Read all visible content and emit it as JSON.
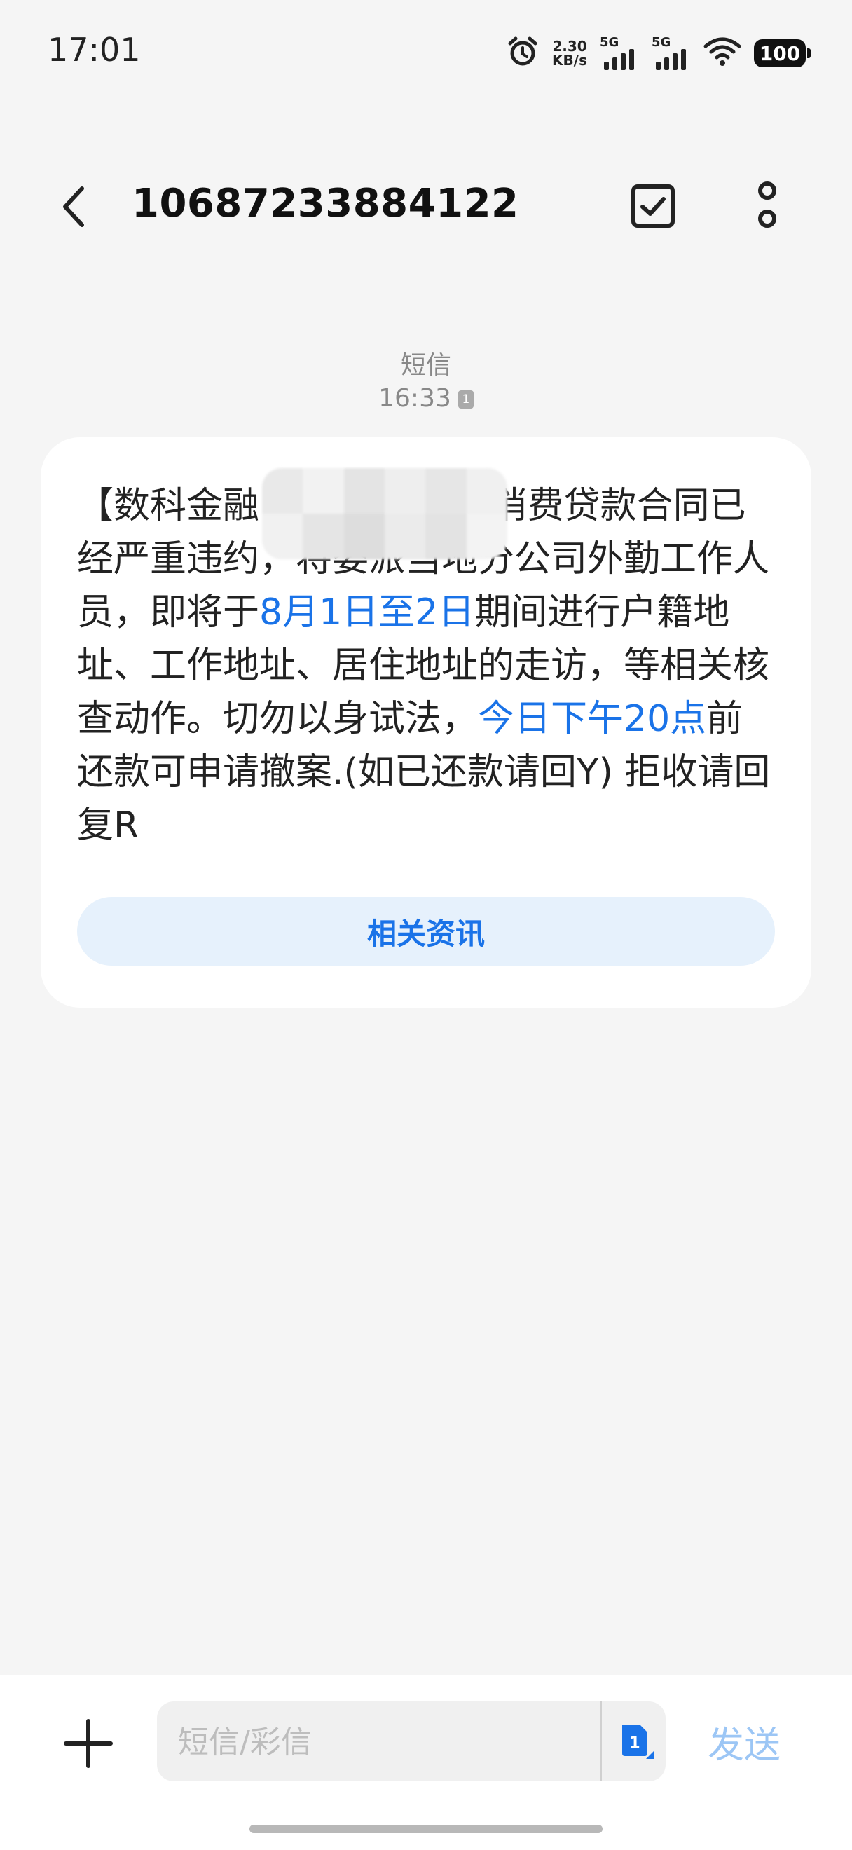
{
  "status_bar": {
    "time": "17:01",
    "net_speed_value": "2.30",
    "net_speed_unit": "KB/s",
    "signal1_label": "5G",
    "signal2_label": "5G",
    "battery": "100"
  },
  "header": {
    "contact": "10687233884122"
  },
  "message": {
    "type": "短信",
    "time": "16:33",
    "sim": "1",
    "text_segments": [
      "【数科金融",
      "                    ",
      "消费贷款合同已经严重违约，将委派当地分公司外勤工作人员，即将于",
      "8月1日至2日",
      "期间进行户籍地址、工作地址、居住地址的走访，等相关核查动作。切勿以身试法，",
      "今日下午20点",
      "前还款可申请撤案.(如已还款请回Y) 拒收请回复R"
    ],
    "related_button": "相关资讯"
  },
  "input_bar": {
    "placeholder": "短信/彩信",
    "sim_switch_label": "1",
    "send": "发送"
  },
  "colors": {
    "accent": "#1a73e8",
    "send_disabled": "#9cc6f5",
    "bubble": "#ffffff",
    "background": "#f5f5f5"
  },
  "icons": [
    "back-arrow-icon",
    "select-checkbox-icon",
    "more-vertical-icon",
    "alarm-icon",
    "wifi-icon",
    "plus-icon",
    "sim-card-icon"
  ]
}
